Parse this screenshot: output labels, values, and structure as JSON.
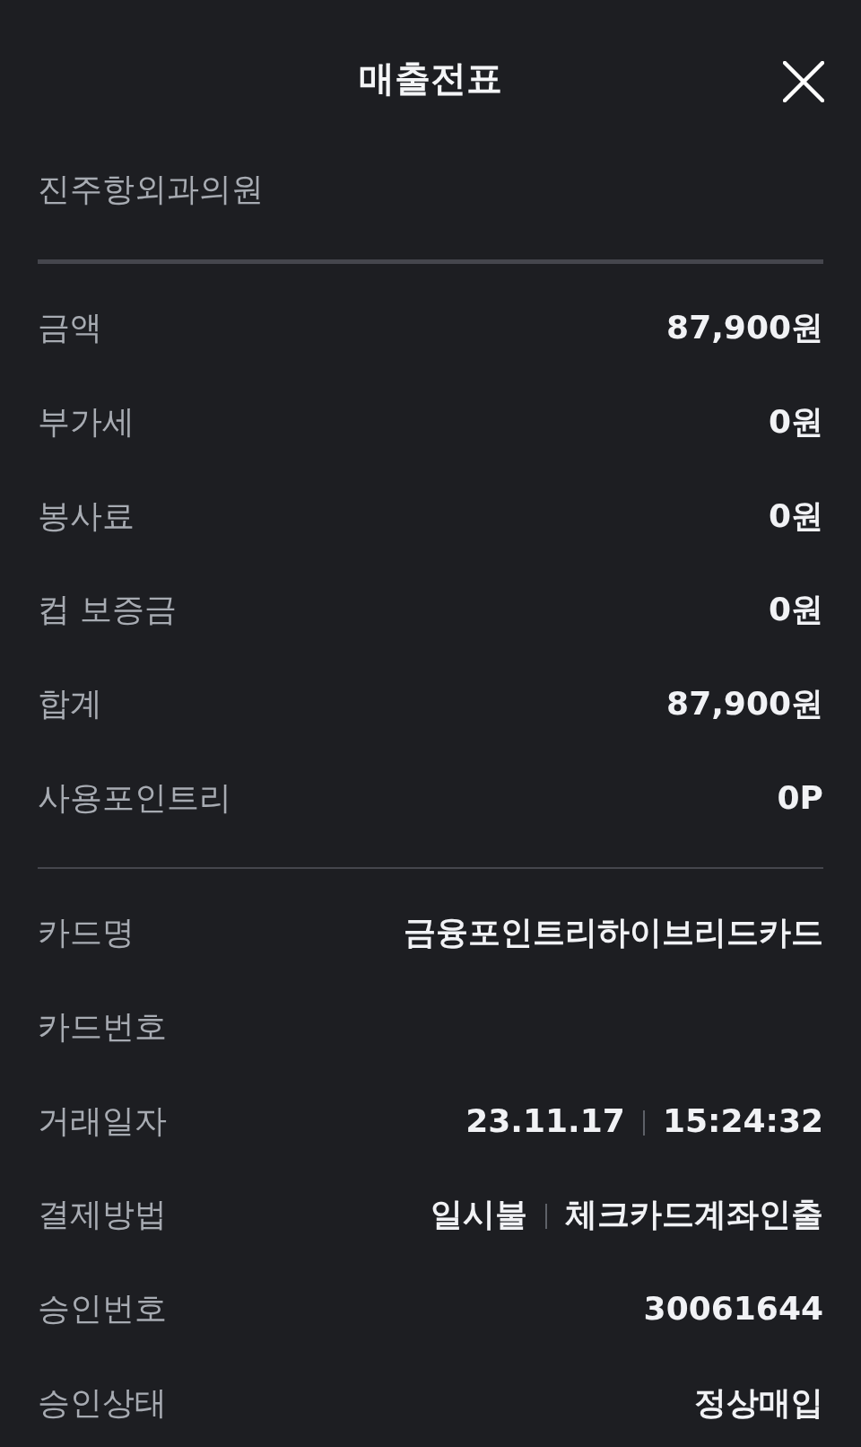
{
  "header": {
    "title": "매출전표"
  },
  "merchant_name": "진주항외과의원",
  "amount_rows": [
    {
      "label": "금액",
      "values": [
        "87,900원"
      ]
    },
    {
      "label": "부가세",
      "values": [
        "0원"
      ]
    },
    {
      "label": "봉사료",
      "values": [
        "0원"
      ]
    },
    {
      "label": "컵 보증금",
      "values": [
        "0원"
      ]
    },
    {
      "label": "합계",
      "values": [
        "87,900원"
      ]
    },
    {
      "label": "사용포인트리",
      "values": [
        "0P"
      ]
    }
  ],
  "card_rows": [
    {
      "label": "카드명",
      "values": [
        "금융포인트리하이브리드카드"
      ]
    },
    {
      "label": "카드번호"
    },
    {
      "label": "거래일자",
      "values": [
        "23.11.17",
        "15:24:32"
      ]
    },
    {
      "label": "결제방법",
      "values": [
        "일시불",
        "체크카드계좌인출"
      ]
    },
    {
      "label": "승인번호",
      "values": [
        "30061644"
      ]
    },
    {
      "label": "승인상태",
      "values": [
        "정상매입"
      ]
    }
  ]
}
